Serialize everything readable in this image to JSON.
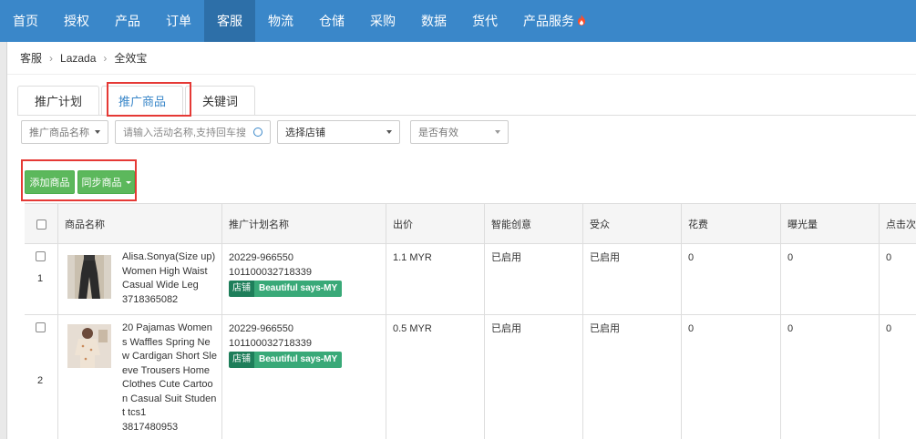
{
  "nav": {
    "items": [
      "首页",
      "授权",
      "产品",
      "订单",
      "客服",
      "物流",
      "仓储",
      "采购",
      "数据",
      "货代",
      "产品服务"
    ],
    "active_index": 4
  },
  "breadcrumb": [
    "客服",
    "Lazada",
    "全效宝"
  ],
  "tabs": [
    "推广计划",
    "推广商品",
    "关键词"
  ],
  "active_tab": 1,
  "filters": {
    "name_select": "推广商品名称",
    "search_placeholder": "请输入活动名称,支持回车搜",
    "shop_select": "选择店铺",
    "valid_select": "是否有效"
  },
  "buttons": {
    "add": "添加商品",
    "sync": "同步商品"
  },
  "table": {
    "headers": [
      "商品名称",
      "推广计划名称",
      "出价",
      "智能创意",
      "受众",
      "花费",
      "曝光量",
      "点击次"
    ],
    "rows": [
      {
        "index": "1",
        "name": "Alisa.Sonya(Size up) Women High Waist Casual Wide Leg",
        "sku": "3718365082",
        "plan_line1": "20229-966550",
        "plan_line2": "101100032718339",
        "tag_label": "店铺",
        "tag_shop": "Beautiful says-MY",
        "bid": "1.1 MYR",
        "smart": "已启用",
        "audience": "已启用",
        "cost": "0",
        "impressions": "0",
        "clicks": "0"
      },
      {
        "index": "2",
        "name": "20 Pajamas Women s Waffles Spring New Cardigan Short Sleeve Trousers Home Clothes Cute Cartoon Casual Suit Student tcs1",
        "sku": "3817480953",
        "plan_line1": "20229-966550",
        "plan_line2": "101100032718339",
        "tag_label": "店铺",
        "tag_shop": "Beautiful says-MY",
        "bid": "0.5 MYR",
        "smart": "已启用",
        "audience": "已启用",
        "cost": "0",
        "impressions": "0",
        "clicks": "0"
      }
    ]
  },
  "colors": {
    "nav_bg": "#3a87c9",
    "nav_active": "#2d6fa8",
    "button_green": "#5cb85c",
    "tag_dark": "#1e7e5a",
    "tag_light": "#39a978",
    "highlight_red": "#e53935"
  }
}
